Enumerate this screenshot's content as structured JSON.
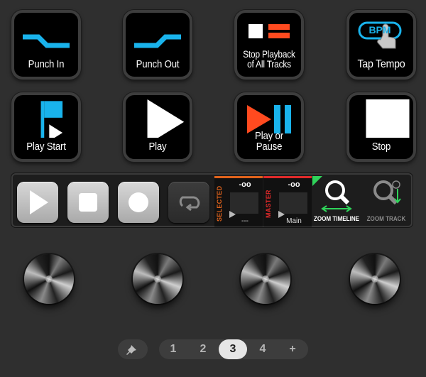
{
  "buttons": [
    {
      "label": "Punch In"
    },
    {
      "label": "Punch Out"
    },
    {
      "label_line1": "Stop Playback",
      "label_line2": "of All Tracks"
    },
    {
      "label": "Tap Tempo",
      "icon_text": "BPM"
    },
    {
      "label": "Play Start"
    },
    {
      "label": "Play"
    },
    {
      "label": "Play or Pause"
    },
    {
      "label": "Stop"
    }
  ],
  "transport": {
    "play": "play-icon",
    "stop": "stop-icon",
    "record": "record-icon",
    "loop": "loop-icon",
    "selected_meter": {
      "db": "-oo",
      "label": "SELECTED",
      "value": "---"
    },
    "master_meter": {
      "db": "-oo",
      "label": "MASTER",
      "value": "Main"
    },
    "zoom_timeline": "ZOOM TIMELINE",
    "zoom_track": "ZOOM TRACK"
  },
  "pages": {
    "items": [
      "1",
      "2",
      "3",
      "4",
      "+"
    ],
    "active": "3"
  },
  "colors": {
    "accent_blue": "#19b3ec",
    "accent_red": "#ff4a1f",
    "selected_orange": "#e0631c",
    "master_red": "#e02a2a",
    "zoom_green": "#2fd45a"
  }
}
